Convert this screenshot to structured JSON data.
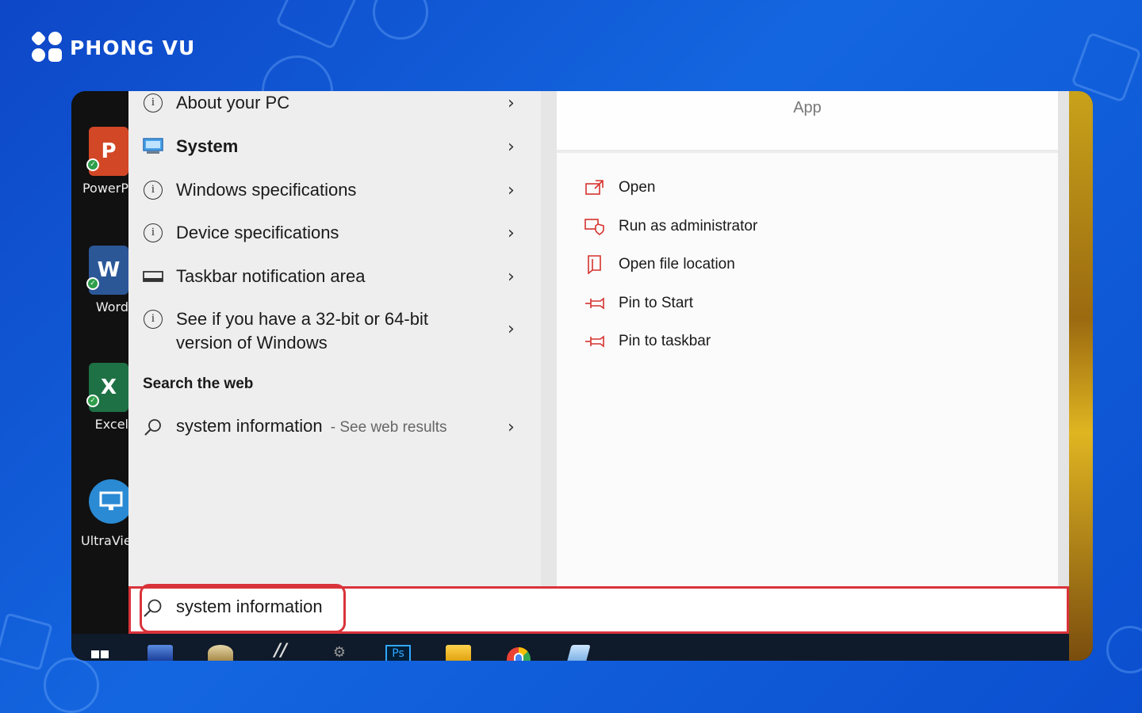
{
  "brand": {
    "name": "PHONG VU"
  },
  "desktop": {
    "icons": [
      {
        "label": "PowerP",
        "glyph": "P",
        "color": "#d24726"
      },
      {
        "label": "Word",
        "glyph": "W",
        "color": "#2b5797"
      },
      {
        "label": "Excel",
        "glyph": "X",
        "color": "#1e7145"
      },
      {
        "label": "UltraVie",
        "glyph": "",
        "color": "#2a8ad4"
      }
    ]
  },
  "results": {
    "items": [
      {
        "label": "About your PC",
        "icon": "info-icon",
        "bold": false
      },
      {
        "label": "System",
        "icon": "monitor-icon",
        "bold": true
      },
      {
        "label": "Windows specifications",
        "icon": "info-icon",
        "bold": false
      },
      {
        "label": "Device specifications",
        "icon": "info-icon",
        "bold": false
      },
      {
        "label": "Taskbar notification area",
        "icon": "taskbar-icon",
        "bold": false
      },
      {
        "label": "See if you have a 32-bit or 64-bit version of Windows",
        "icon": "info-icon",
        "bold": false
      }
    ],
    "web_section_title": "Search the web",
    "web_item": {
      "query": "system information",
      "suffix": "- See web results"
    }
  },
  "detail": {
    "type_label": "App",
    "actions": [
      {
        "label": "Open",
        "icon": "open-icon"
      },
      {
        "label": "Run as administrator",
        "icon": "shield-icon"
      },
      {
        "label": "Open file location",
        "icon": "folder-icon"
      },
      {
        "label": "Pin to Start",
        "icon": "pin-icon"
      },
      {
        "label": "Pin to taskbar",
        "icon": "pin-icon"
      }
    ]
  },
  "search": {
    "value": "system information"
  },
  "taskbar": {
    "apps": [
      "start",
      "network",
      "paint",
      "notepad",
      "settings",
      "photoshop",
      "file-explorer",
      "chrome",
      "snipping-tool"
    ]
  },
  "colors": {
    "highlight": "#d9333a",
    "accent_action": "#d6332e",
    "background": "#0d47c7"
  }
}
